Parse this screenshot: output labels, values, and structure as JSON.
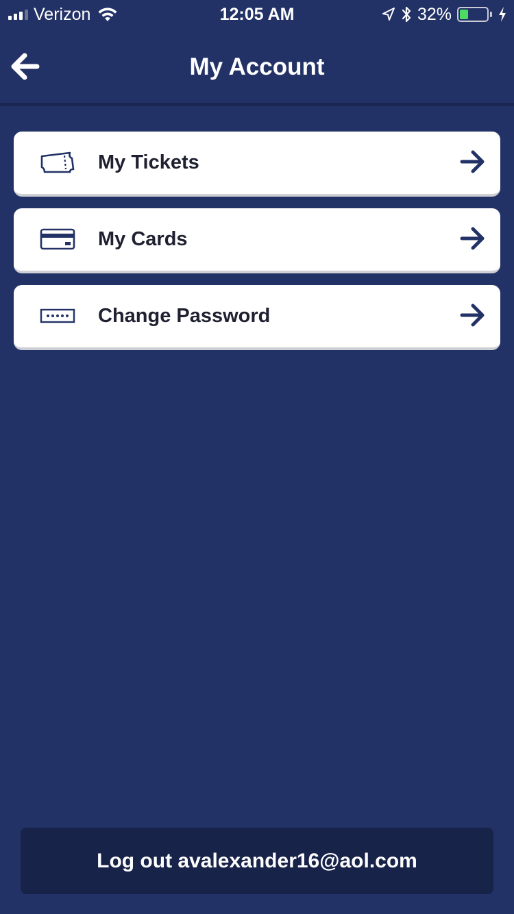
{
  "status_bar": {
    "carrier": "Verizon",
    "time": "12:05 AM",
    "battery_percent_text": "32%",
    "battery_level": 0.32
  },
  "header": {
    "title": "My Account",
    "back_icon": "arrow-left-icon"
  },
  "menu": {
    "items": [
      {
        "label": "My Tickets",
        "icon": "ticket-icon"
      },
      {
        "label": "My Cards",
        "icon": "credit-card-icon"
      },
      {
        "label": "Change Password",
        "icon": "password-field-icon"
      }
    ],
    "chevron_icon": "arrow-right-icon"
  },
  "footer": {
    "logout_label": "Log out avalexander16@aol.com"
  },
  "colors": {
    "background": "#233266",
    "card": "#ffffff",
    "card_text": "#1f2030",
    "accent_icon": "#233266",
    "logout_button": "#18234a",
    "battery_fill": "#4cd964"
  }
}
